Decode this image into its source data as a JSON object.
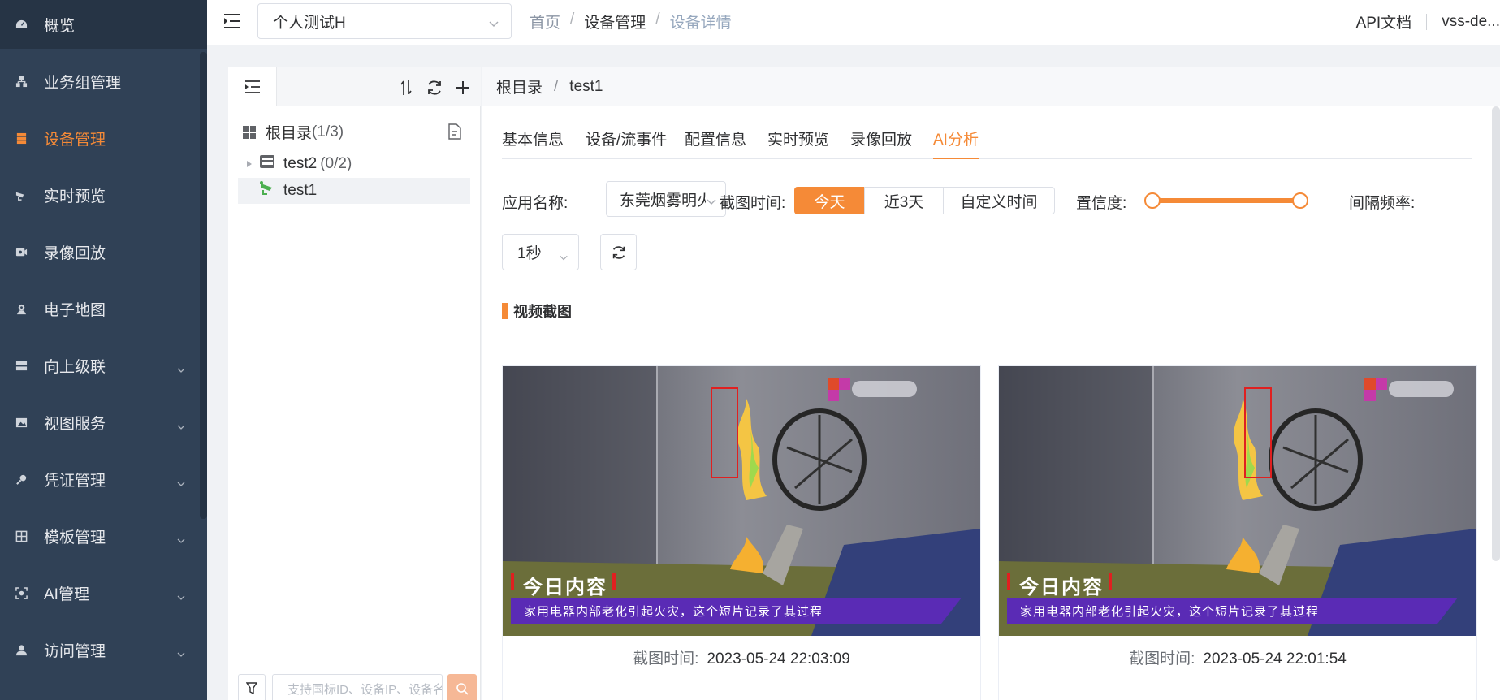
{
  "sidebar": {
    "items": [
      {
        "label": "概览",
        "icon": "dashboard-icon"
      },
      {
        "label": "业务组管理",
        "icon": "org-tree-icon"
      },
      {
        "label": "设备管理",
        "icon": "device-list-icon",
        "active": true
      },
      {
        "label": "实时预览",
        "icon": "camera-icon"
      },
      {
        "label": "录像回放",
        "icon": "video-playback-icon"
      },
      {
        "label": "电子地图",
        "icon": "map-pin-icon"
      },
      {
        "label": "向上级联",
        "icon": "server-icon",
        "expandable": true
      },
      {
        "label": "视图服务",
        "icon": "image-icon",
        "expandable": true
      },
      {
        "label": "凭证管理",
        "icon": "key-icon",
        "expandable": true
      },
      {
        "label": "模板管理",
        "icon": "grid-icon",
        "expandable": true
      },
      {
        "label": "AI管理",
        "icon": "ai-scan-icon",
        "expandable": true
      },
      {
        "label": "访问管理",
        "icon": "user-icon",
        "expandable": true
      }
    ]
  },
  "header": {
    "project": "个人测试H",
    "breadcrumb": [
      "首页",
      "设备管理",
      "设备详情"
    ],
    "api_doc": "API文档",
    "user": "vss-de..."
  },
  "tree": {
    "root_label": "根目录",
    "root_count": "(1/3)",
    "nodes": [
      {
        "label": "test2",
        "count": "(0/2)"
      },
      {
        "label": "test1",
        "count": ""
      }
    ],
    "search_placeholder": "支持国标ID、设备IP、设备名称"
  },
  "content": {
    "breadcrumb": [
      "根目录",
      "test1"
    ],
    "tabs": [
      "基本信息",
      "设备/流事件",
      "配置信息",
      "实时预览",
      "录像回放",
      "AI分析"
    ],
    "active_tab": "AI分析",
    "filters": {
      "app_label": "应用名称:",
      "app_value": "东莞烟雾明火",
      "time_label": "截图时间:",
      "time_options": [
        "今天",
        "近3天",
        "自定义时间"
      ],
      "time_active": "今天",
      "confidence_label": "置信度:",
      "confidence_range": [
        0,
        1
      ],
      "interval_label": "间隔频率:",
      "interval_value": "1秒"
    },
    "section_title": "视频截图",
    "snapshots": [
      {
        "time_label": "截图时间:",
        "time": "2023-05-24 22:03:09",
        "overlay_title": "今日内容",
        "overlay_sub": "家用电器内部老化引起火灾，这个短片记录了其过程"
      },
      {
        "time_label": "截图时间:",
        "time": "2023-05-24 22:01:54",
        "overlay_title": "今日内容",
        "overlay_sub": "家用电器内部老化引起火灾，这个短片记录了其过程"
      }
    ]
  },
  "colors": {
    "sidebar_bg": "#304156",
    "accent": "#f58a37",
    "detect_box": "#e02020"
  }
}
